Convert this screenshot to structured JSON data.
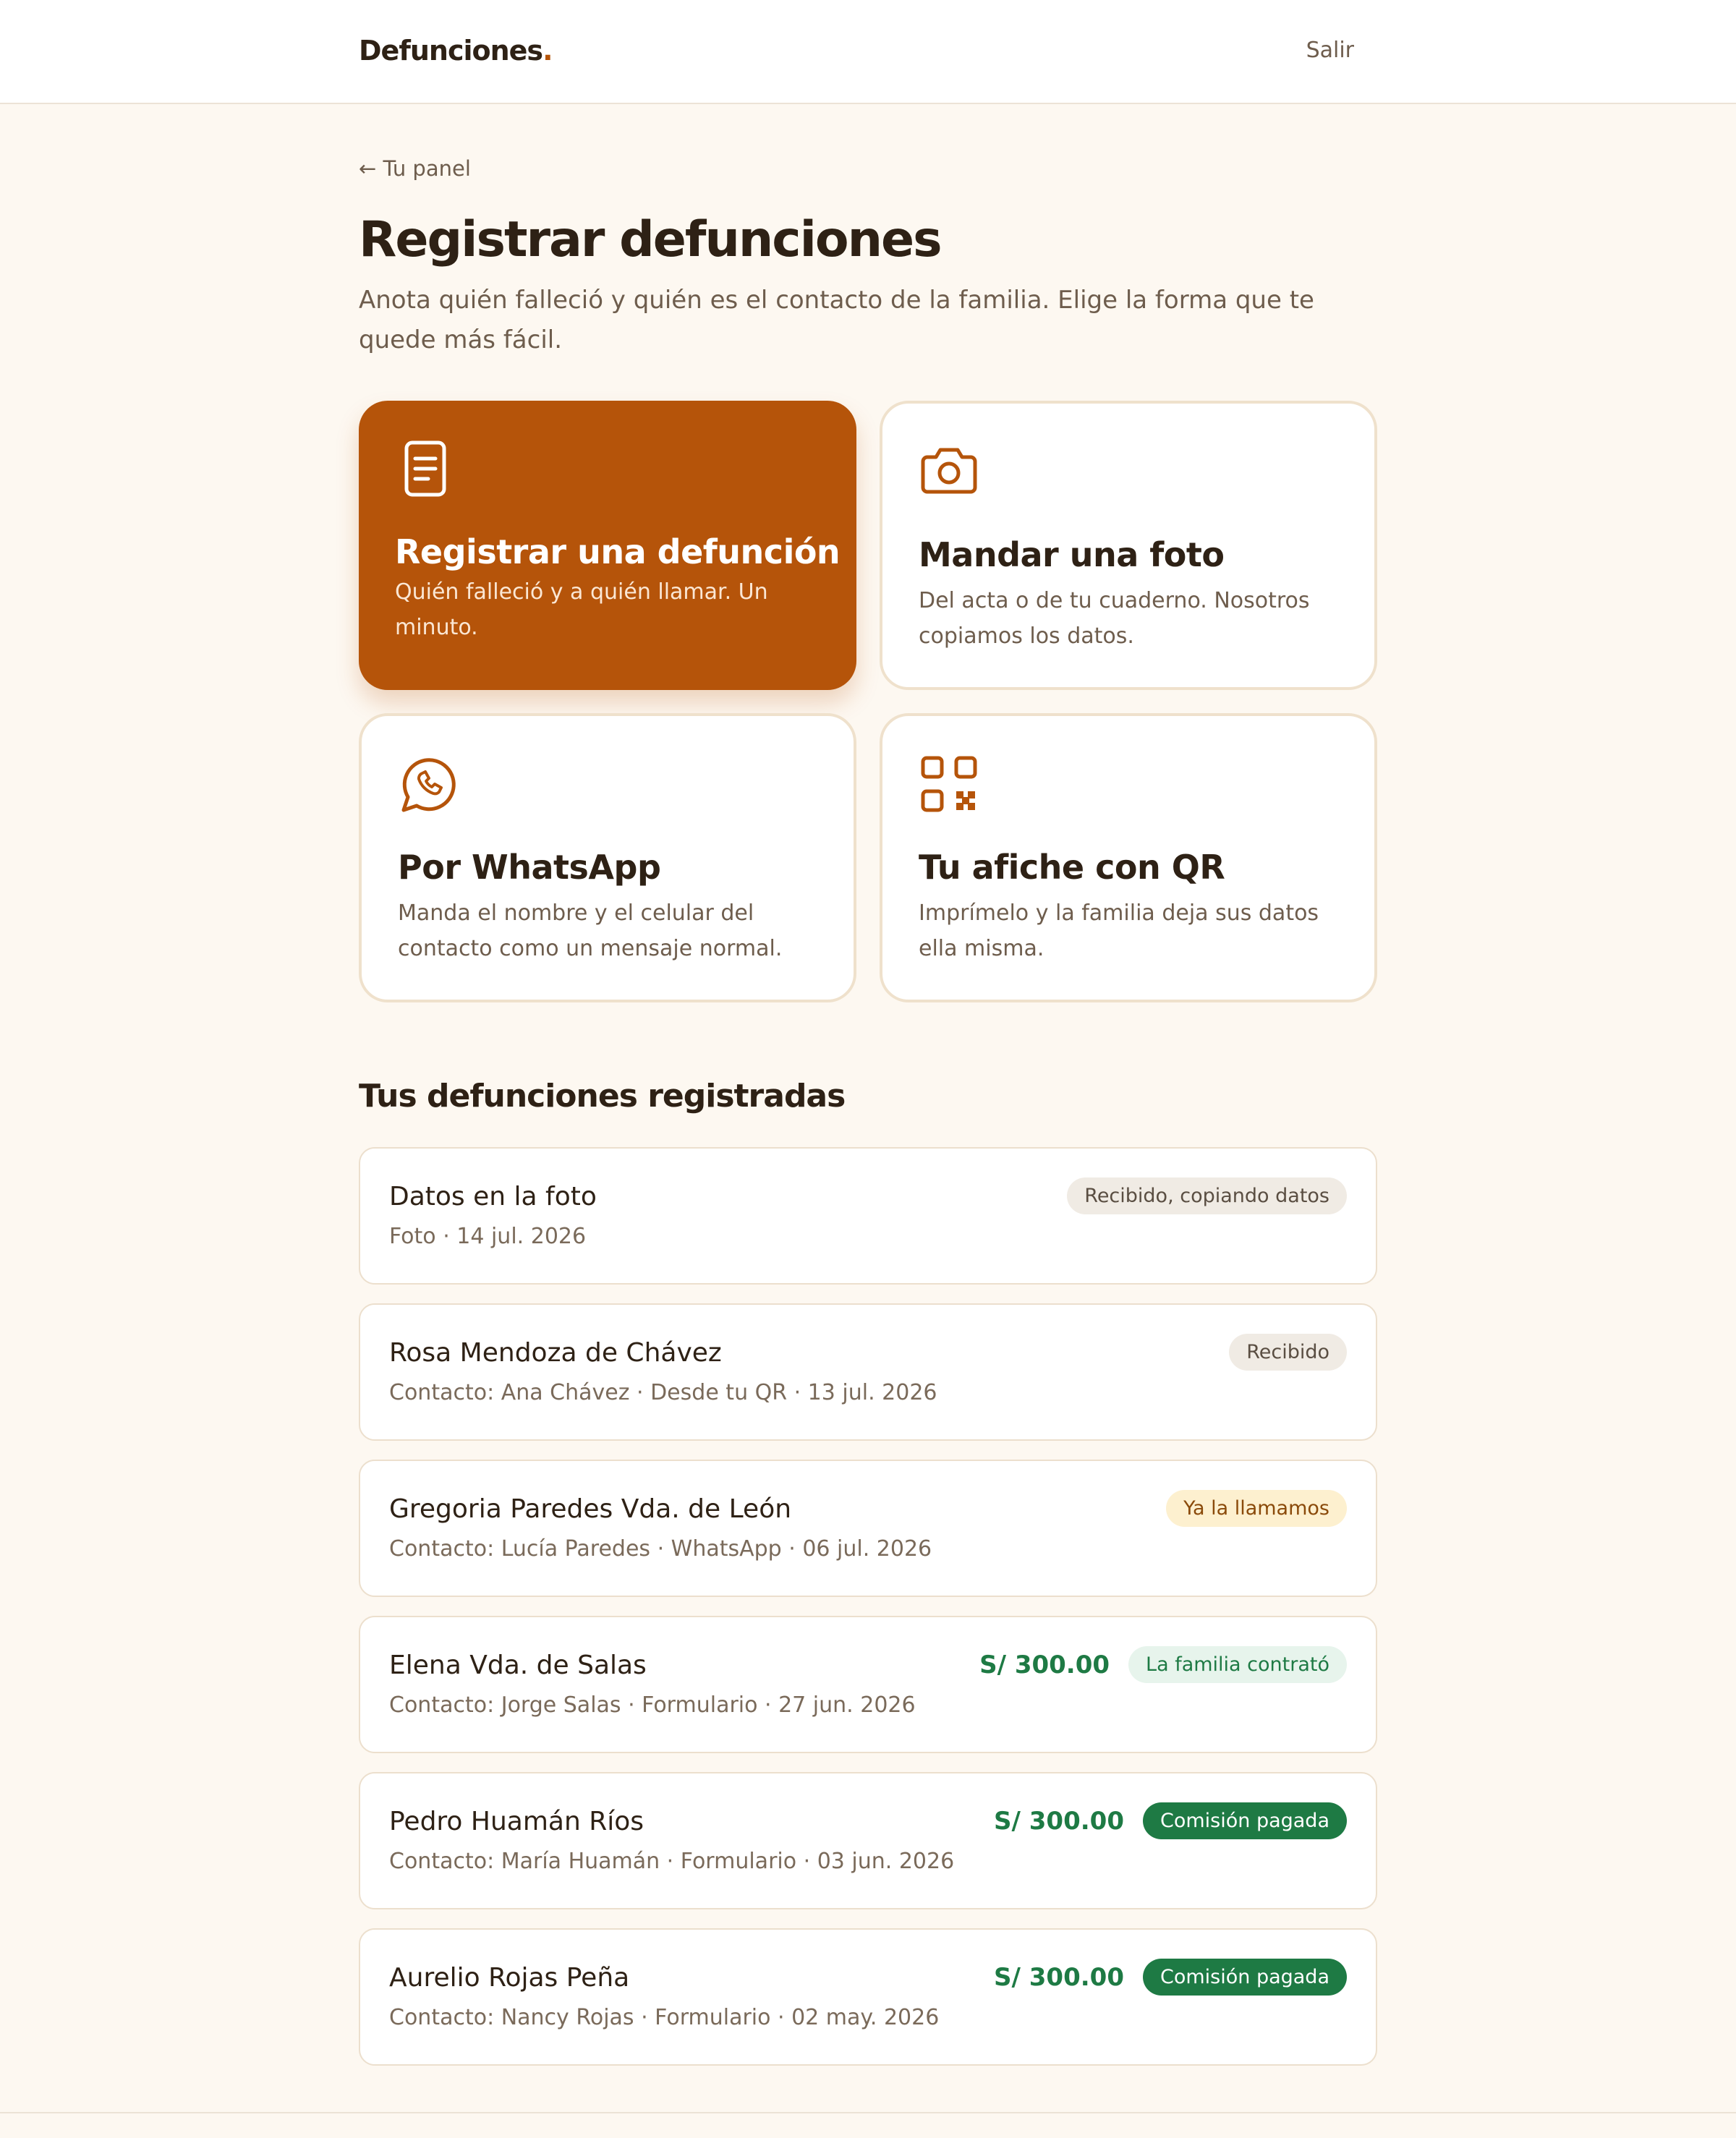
{
  "header": {
    "brand": "Defunciones",
    "brand_dot": ".",
    "logout_label": "Salir"
  },
  "nav": {
    "back_label": "← Tu panel"
  },
  "page": {
    "title": "Registrar defunciones",
    "subtitle": "Anota quién falleció y quién es el contacto de la familia. Elige la forma que te quede más fácil."
  },
  "options": [
    {
      "title": "Registrar una defunción",
      "description": "Quién falleció y a quién llamar. Un minuto.",
      "icon": "document-icon"
    },
    {
      "title": "Mandar una foto",
      "description": "Del acta o de tu cuaderno. Nosotros copiamos los datos.",
      "icon": "camera-icon"
    },
    {
      "title": "Por WhatsApp",
      "description": "Manda el nombre y el celular del contacto como un mensaje normal.",
      "icon": "whatsapp-icon"
    },
    {
      "title": "Tu afiche con QR",
      "description": "Imprímelo y la familia deja sus datos ella misma.",
      "icon": "qr-code-icon"
    }
  ],
  "records_section": {
    "title": "Tus defunciones registradas",
    "items": [
      {
        "name": "Datos en la foto",
        "meta": "Foto · 14 jul. 2026",
        "amount": "",
        "status": "Recibido, copiando datos",
        "status_style": "grey"
      },
      {
        "name": "Rosa Mendoza de Chávez",
        "meta": "Contacto: Ana Chávez · Desde tu QR · 13 jul. 2026",
        "amount": "",
        "status": "Recibido",
        "status_style": "grey"
      },
      {
        "name": "Gregoria Paredes Vda. de León",
        "meta": "Contacto: Lucía Paredes · WhatsApp · 06 jul. 2026",
        "amount": "",
        "status": "Ya la llamamos",
        "status_style": "yellow"
      },
      {
        "name": "Elena Vda. de Salas",
        "meta": "Contacto: Jorge Salas · Formulario · 27 jun. 2026",
        "amount": "S/ 300.00",
        "status": "La familia contrató",
        "status_style": "lightgreen"
      },
      {
        "name": "Pedro Huamán Ríos",
        "meta": "Contacto: María Huamán · Formulario · 03 jun. 2026",
        "amount": "S/ 300.00",
        "status": "Comisión pagada",
        "status_style": "green"
      },
      {
        "name": "Aurelio Rojas Peña",
        "meta": "Contacto: Nancy Rojas · Formulario · 02 may. 2026",
        "amount": "S/ 300.00",
        "status": "Comisión pagada",
        "status_style": "green"
      }
    ]
  },
  "colors": {
    "accent": "#b5540a",
    "background": "#fdf8f1",
    "success": "#1e7a44"
  }
}
